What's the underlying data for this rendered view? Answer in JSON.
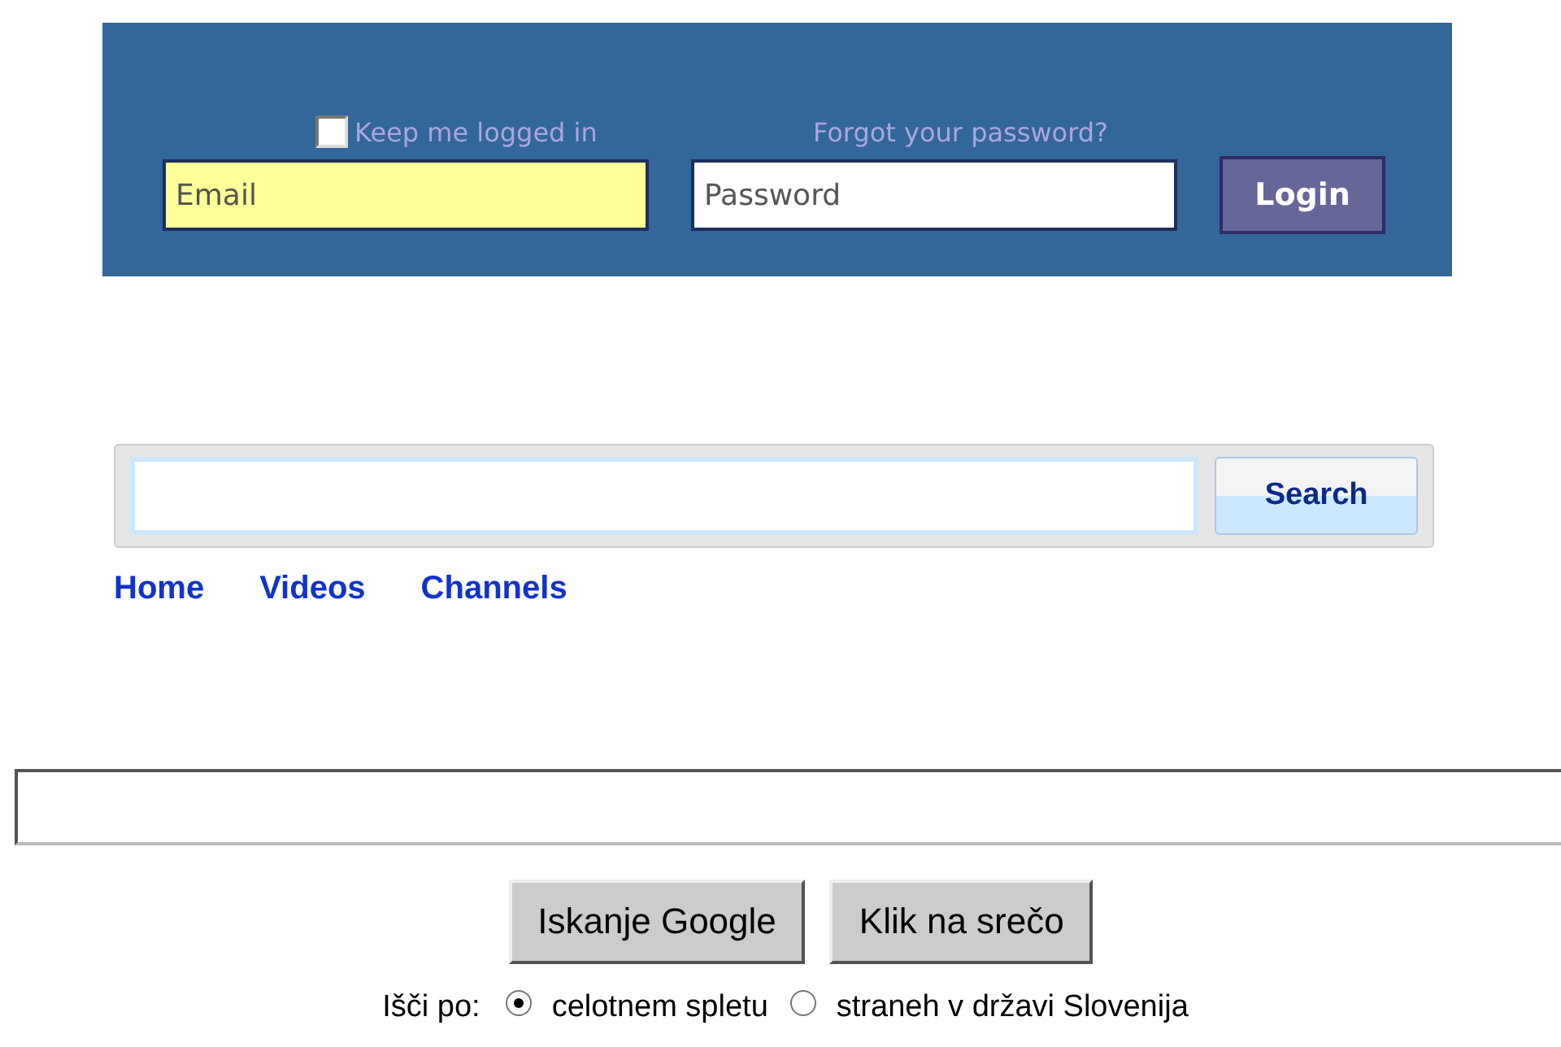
{
  "login": {
    "keep_logged_in": {
      "label": "Keep me logged in",
      "checked": false
    },
    "forgot_link": "Forgot your password?",
    "email": {
      "placeholder": "Email"
    },
    "password": {
      "placeholder": "Password"
    },
    "button": "Login"
  },
  "video_search": {
    "button": "Search"
  },
  "nav": [
    "Home",
    "Videos",
    "Channels"
  ],
  "google": {
    "buttons": [
      "Iskanje Google",
      "Klik na srečo"
    ],
    "scope_label": "Išči po:",
    "scopes": [
      {
        "label": "celotnem spletu",
        "selected": true
      },
      {
        "label": "straneh v državi Slovenija",
        "selected": false
      }
    ]
  }
}
